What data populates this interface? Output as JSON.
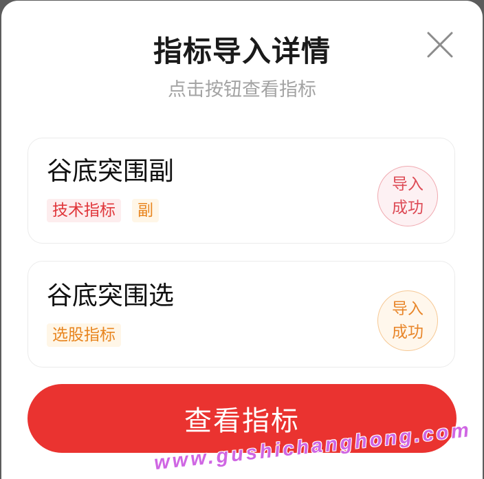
{
  "dialog": {
    "title": "指标导入详情",
    "subtitle": "点击按钮查看指标",
    "close_icon": "close-icon"
  },
  "indicators": [
    {
      "name": "谷底突围副",
      "tags": [
        {
          "label": "技术指标",
          "color": "#e0353a",
          "bg": "#fdedee"
        },
        {
          "label": "副",
          "color": "#e8851f",
          "bg": "#fff6e7"
        }
      ],
      "status_line1": "导入",
      "status_line2": "成功",
      "status_color": "#dd4a55",
      "status_border": "#f0a9b0",
      "status_bg": "#fdf1f3"
    },
    {
      "name": "谷底突围选",
      "tags": [
        {
          "label": "选股指标",
          "color": "#e8851f",
          "bg": "#fff6e7"
        }
      ],
      "status_line1": "导入",
      "status_line2": "成功",
      "status_color": "#e8862a",
      "status_border": "#f6c894",
      "status_bg": "#fff7ec"
    }
  ],
  "button": {
    "label": "查看指标",
    "color": "#ea3330"
  },
  "watermark": {
    "text": "www.gushichanghong.com",
    "color": "#cf66e3"
  }
}
